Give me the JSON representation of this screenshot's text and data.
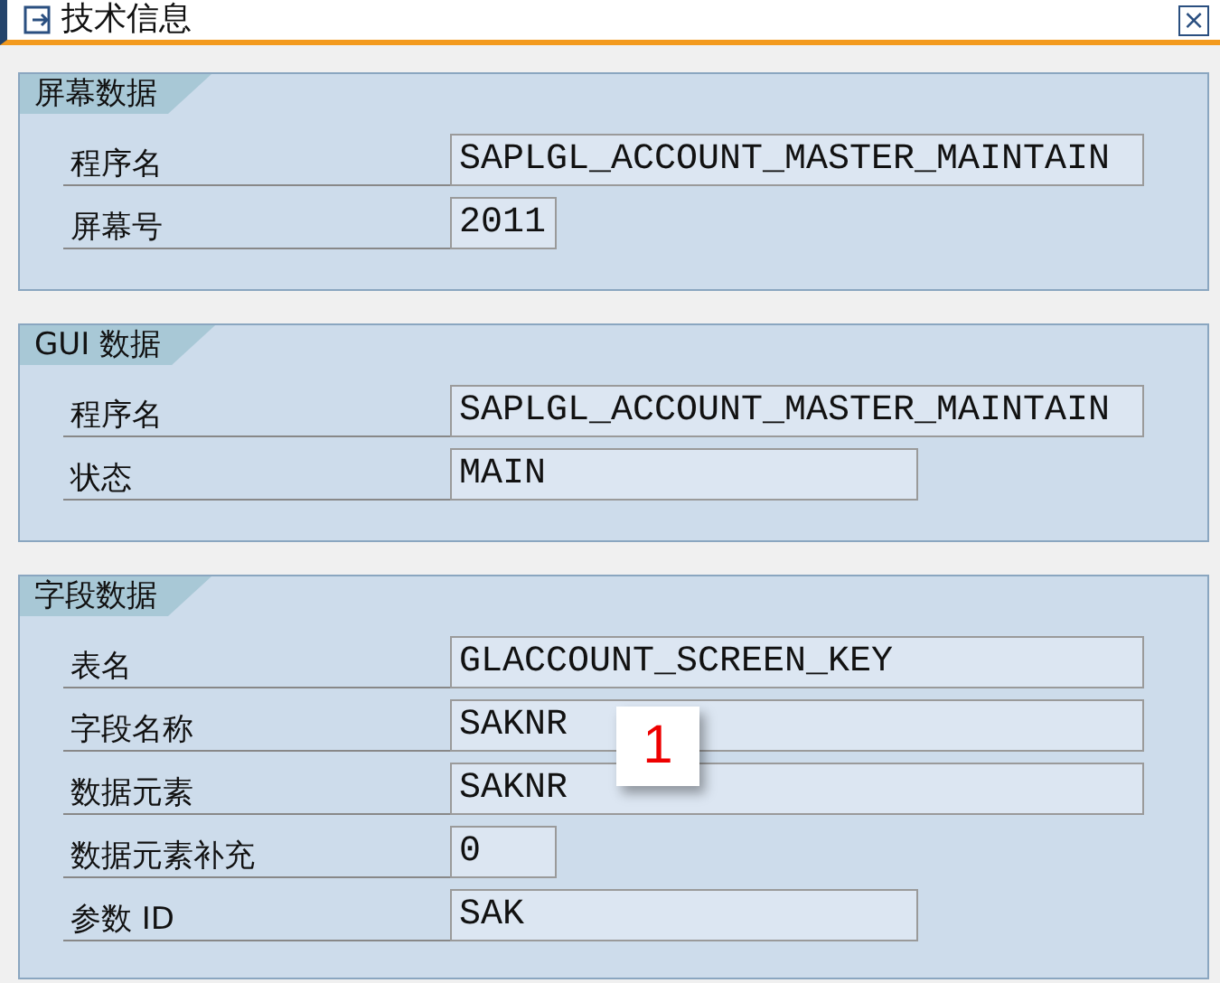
{
  "window": {
    "title": "技术信息",
    "close": "×"
  },
  "groups": [
    {
      "title": "屏幕数据",
      "rows": [
        {
          "label": "程序名",
          "value": "SAPLGL_ACCOUNT_MASTER_MAINTAIN",
          "kind": "long"
        },
        {
          "label": "屏幕号",
          "value": "2011",
          "kind": "short"
        }
      ]
    },
    {
      "title": "GUI 数据",
      "rows": [
        {
          "label": "程序名",
          "value": "SAPLGL_ACCOUNT_MASTER_MAINTAIN",
          "kind": "long"
        },
        {
          "label": "状态",
          "value": "MAIN",
          "kind": "medium"
        }
      ]
    },
    {
      "title": "字段数据",
      "rows": [
        {
          "label": "表名",
          "value": "GLACCOUNT_SCREEN_KEY",
          "kind": "long"
        },
        {
          "label": "字段名称",
          "value": "SAKNR",
          "kind": "long"
        },
        {
          "label": "数据元素",
          "value": "SAKNR",
          "kind": "long"
        },
        {
          "label": "数据元素补充",
          "value": "0",
          "kind": "short"
        },
        {
          "label": "参数 ID",
          "value": "SAK",
          "kind": "medium"
        }
      ]
    }
  ],
  "callout": {
    "text": "1"
  }
}
